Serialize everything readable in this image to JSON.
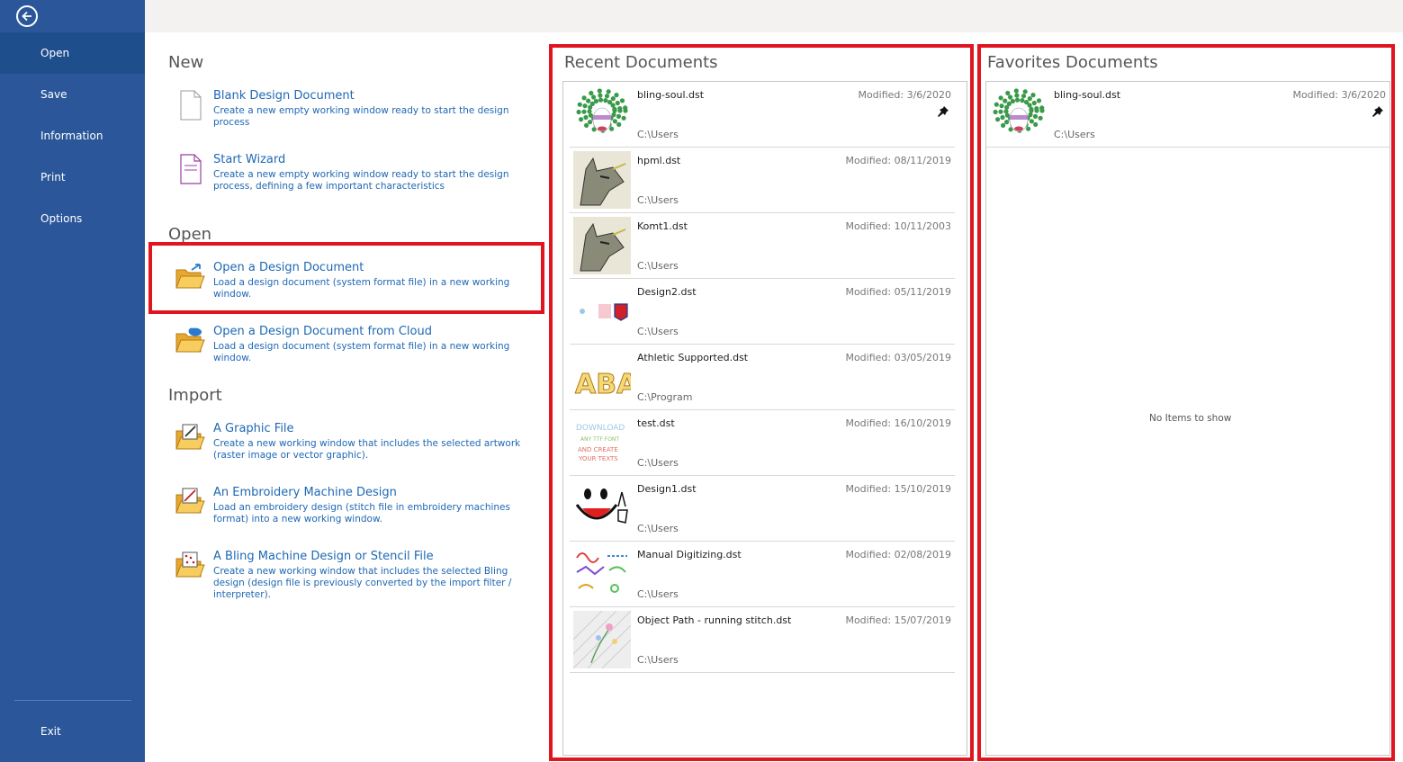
{
  "sidebar": {
    "back_icon": "back-arrow-icon",
    "items": [
      {
        "label": "Open"
      },
      {
        "label": "Save"
      },
      {
        "label": "Information"
      },
      {
        "label": "Print"
      },
      {
        "label": "Options"
      }
    ],
    "exit_label": "Exit",
    "bg_color": "#2b579a",
    "active_color": "#1e4e8c"
  },
  "new_section": {
    "title": "New",
    "items": [
      {
        "title": "Blank Design Document",
        "desc": "Create a new empty working window ready to start the design process",
        "icon": "blank-document-icon"
      },
      {
        "title": "Start Wizard",
        "desc": "Create a new empty working window ready to start the design process, defining a few important characteristics",
        "icon": "wizard-document-icon"
      }
    ]
  },
  "open_section": {
    "title": "Open",
    "items": [
      {
        "title": "Open a Design Document",
        "desc": "Load a design document (system format file) in a new working window.",
        "icon": "open-folder-icon"
      },
      {
        "title": "Open a Design Document from Cloud",
        "desc": "Load a design document (system format file) in a new working window.",
        "icon": "cloud-folder-icon"
      }
    ]
  },
  "import_section": {
    "title": "Import",
    "items": [
      {
        "title": "A Graphic File",
        "desc": "Create a new working window that includes the selected artwork (raster image or vector graphic).",
        "icon": "graphic-import-icon"
      },
      {
        "title": "An Embroidery Machine Design",
        "desc": "Load an embroidery design (stitch file in embroidery machines format) into a new working window.",
        "icon": "embroidery-import-icon"
      },
      {
        "title": "A Bling Machine Design or Stencil File",
        "desc": "Create a new working window that includes the selected Bling design (design file is previously converted by the import filter / interpreter).",
        "icon": "bling-import-icon"
      }
    ]
  },
  "recent": {
    "title": "Recent Documents",
    "items": [
      {
        "name": "bling-soul.dst",
        "modified": "Modified: 3/6/2020",
        "path": "C:\\Users",
        "pinned": true,
        "thumb": "bling"
      },
      {
        "name": "hpml.dst",
        "modified": "Modified: 08/11/2019",
        "path": "C:\\Users",
        "pinned": false,
        "thumb": "wolf"
      },
      {
        "name": "Komt1.dst",
        "modified": "Modified: 10/11/2003",
        "path": "C:\\Users",
        "pinned": false,
        "thumb": "wolf"
      },
      {
        "name": "Design2.dst",
        "modified": "Modified: 05/11/2019",
        "path": "C:\\Users",
        "pinned": false,
        "thumb": "design2"
      },
      {
        "name": "Athletic Supported.dst",
        "modified": "Modified: 03/05/2019",
        "path": "C:\\Program",
        "pinned": false,
        "thumb": "aba"
      },
      {
        "name": "test.dst",
        "modified": "Modified: 16/10/2019",
        "path": "C:\\Users",
        "pinned": false,
        "thumb": "test"
      },
      {
        "name": "Design1.dst",
        "modified": "Modified: 15/10/2019",
        "path": "C:\\Users",
        "pinned": false,
        "thumb": "smile"
      },
      {
        "name": "Manual Digitizing.dst",
        "modified": "Modified: 02/08/2019",
        "path": "C:\\Users",
        "pinned": false,
        "thumb": "manual"
      },
      {
        "name": "Object Path - running stitch.dst",
        "modified": "Modified: 15/07/2019",
        "path": "C:\\Users",
        "pinned": false,
        "thumb": "flower"
      }
    ]
  },
  "favorites": {
    "title": "Favorites Documents",
    "items": [
      {
        "name": "bling-soul.dst",
        "modified": "Modified: 3/6/2020",
        "path": "C:\\Users",
        "pinned": true,
        "thumb": "bling"
      }
    ],
    "empty_text": "No Items to show"
  },
  "pin_icon": "pin-icon",
  "highlight_color": "#e0151f",
  "link_color": "#1e68b4"
}
